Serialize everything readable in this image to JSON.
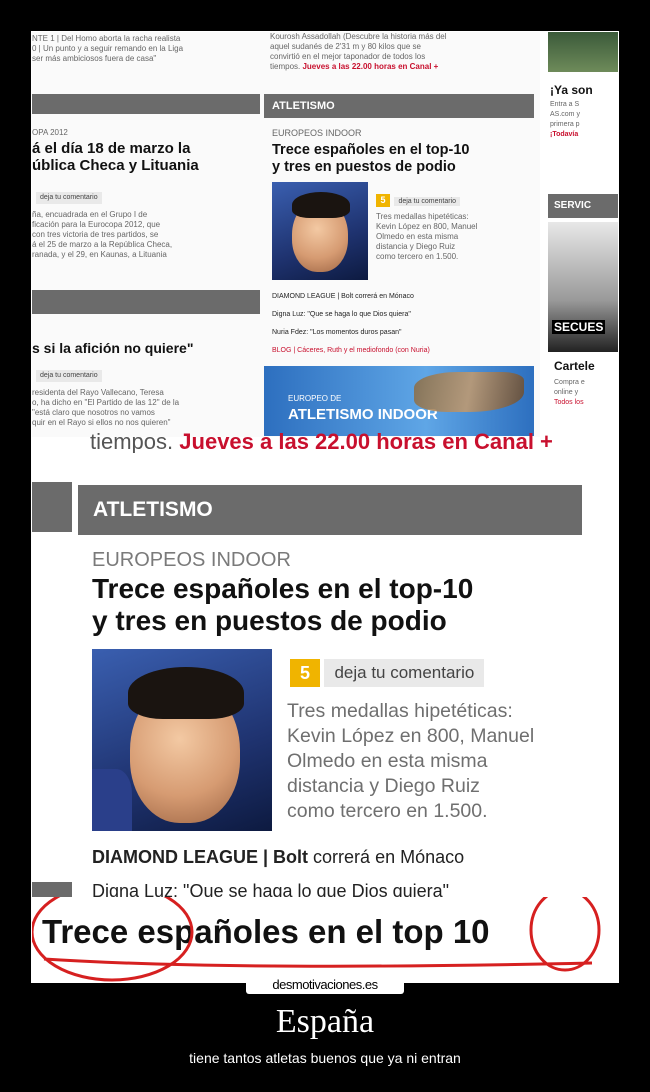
{
  "top": {
    "left_lines": [
      "NTE 1 | Del Homo aborta la racha realista",
      "0 | Un punto y a seguir remando en la Liga",
      "ser más ambiciosos fuera de casa\""
    ],
    "left_section_small": "OPA 2012",
    "left_headline": [
      "á el día 18 de marzo la",
      "ública Checa y Lituania"
    ],
    "left_comment": "deja tu comentario",
    "left_body": [
      "ña, encuadrada en el Grupo I de",
      "ficación para la Eurocopa 2012, que",
      "con tres victoria de tres partidos, se",
      "á el 25 de marzo a la República Checa,",
      "ranada, y el 29, en Kaunas, a Lituania"
    ],
    "left_headline2": "s si la afición no quiere\"",
    "left_comment2": "deja tu comentario",
    "left_body2": [
      "residenta del Rayo Vallecano, Teresa",
      "o, ha dicho en \"El Partido de las 12\" de la",
      "\"está claro que nosotros no vamos",
      "quir en el Rayo si ellos no nos quieren\""
    ],
    "mid_top_text": [
      "Kourosh Assadollah (Descubre la historia más del",
      "aquel sudanés de 2'31 m y 80 kilos que se",
      "convirtió en el mejor taponador de todos los",
      "tiempos."
    ],
    "mid_top_link": "Jueves a las 22.00 horas en Canal +",
    "section_bar": "ATLETISMO",
    "kicker": "EUROPEOS INDOOR",
    "headline": [
      "Trece españoles en el top-10",
      "y tres en puestos de podio"
    ],
    "badge": "5",
    "comment": "deja tu comentario",
    "body": [
      "Tres medallas hipetéticas:",
      "Kevin López en 800, Manuel",
      "Olmedo en esta misma",
      "distancia y Diego Ruiz",
      "como tercero en 1.500."
    ],
    "bullets": [
      "DIAMOND LEAGUE | Bolt correrá en Mónaco",
      "Digna Luz: \"Que se haga lo que Dios quiera\"",
      "Nuria Fdez: \"Los momentos duros pasan\""
    ],
    "blog_line": "BLOG | Cáceres, Ruth y el mediofondo (con Nuria)",
    "banner_small": "EUROPEO DE",
    "banner_big": "ATLETISMO INDOOR",
    "right_head": "¡Ya son",
    "right_lines": [
      "Entra a S",
      "AS.com y",
      "primera p"
    ],
    "right_link": "¡Todavía",
    "right_bar": "SERVIC",
    "right_poster": "SECUES",
    "right_cartel": "Cartele",
    "right_cartel_lines": [
      "Compra e",
      "online y",
      "Todos los"
    ]
  },
  "zoom": {
    "top_text": "tiempos.",
    "top_link": "Jueves a las 22.00 horas en Canal +",
    "section_bar": "ATLETISMO",
    "kicker": "EUROPEOS INDOOR",
    "headline": [
      "Trece españoles en el top-10",
      "y tres en puestos de podio"
    ],
    "badge": "5",
    "comment": "deja tu comentario",
    "body": [
      "Tres medallas hipetéticas:",
      "Kevin López en 800, Manuel",
      "Olmedo en esta misma",
      "distancia y Diego Ruiz",
      "como tercero en 1.500."
    ],
    "bullet1_bold": "DIAMOND LEAGUE | Bolt",
    "bullet1_rest": "correrá en Mónaco",
    "bullet2": "Digna Luz: \"Que se haga lo que Dios quiera\"",
    "big_text": "Trece españoles en el top 10"
  },
  "watermark": "desmotivaciones.es",
  "caption": {
    "title": "España",
    "subtitle": "tiene tantos atletas buenos que ya ni entran"
  },
  "colors": {
    "section_bar": "#6b6b6b",
    "badge": "#f0b400",
    "link_red": "#c8102e",
    "circle_red": "#d62020"
  }
}
